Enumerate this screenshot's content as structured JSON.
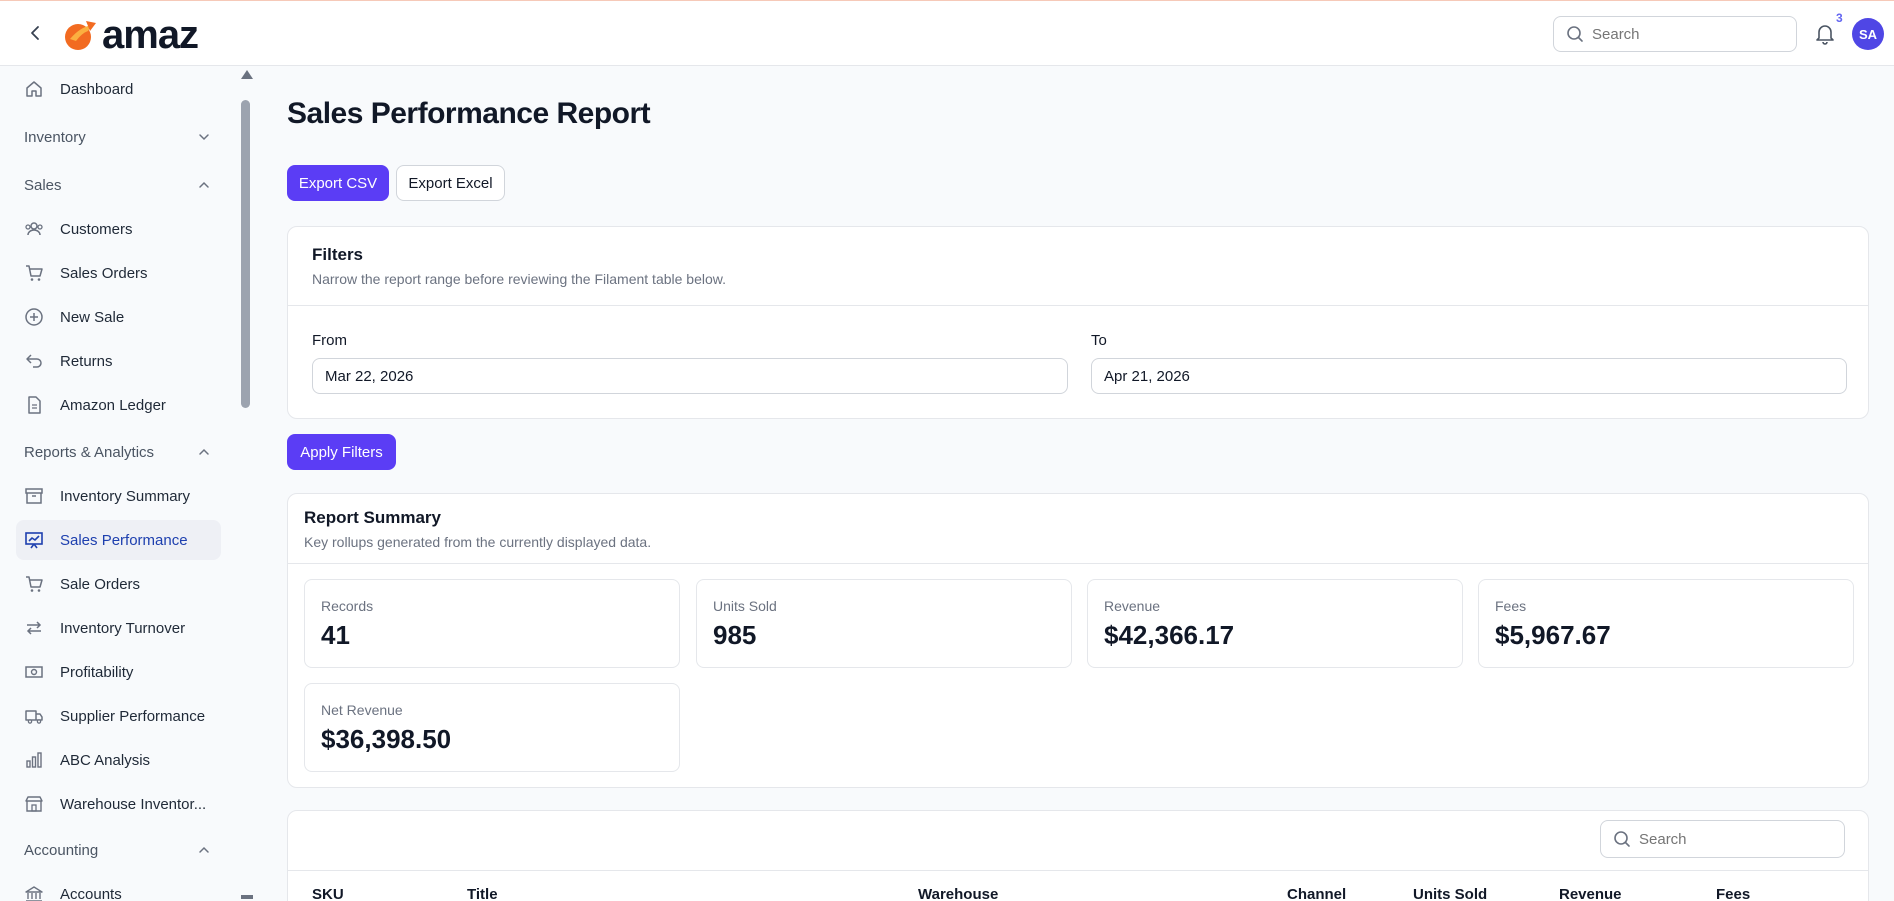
{
  "header": {
    "logo_text": "amaz",
    "search_placeholder": "Search",
    "notification_count": "3",
    "avatar_initials": "SA"
  },
  "sidebar": {
    "dashboard": "Dashboard",
    "groups": {
      "inventory": "Inventory",
      "sales": "Sales",
      "reports": "Reports & Analytics",
      "accounting": "Accounting"
    },
    "sales_items": [
      "Customers",
      "Sales Orders",
      "New Sale",
      "Returns",
      "Amazon Ledger"
    ],
    "report_items": [
      "Inventory Summary",
      "Sales Performance",
      "Sale Orders",
      "Inventory Turnover",
      "Profitability",
      "Supplier Performance",
      "ABC Analysis",
      "Warehouse Inventor..."
    ],
    "accounting_items": [
      "Accounts"
    ]
  },
  "main": {
    "title": "Sales Performance Report",
    "export_csv": "Export CSV",
    "export_excel": "Export Excel",
    "filters": {
      "title": "Filters",
      "subtitle": "Narrow the report range before reviewing the Filament table below.",
      "from_label": "From",
      "from_value": "Mar 22, 2026",
      "to_label": "To",
      "to_value": "Apr 21, 2026"
    },
    "apply_filters": "Apply Filters",
    "summary": {
      "title": "Report Summary",
      "subtitle": "Key rollups generated from the currently displayed data.",
      "stats": [
        {
          "label": "Records",
          "value": "41"
        },
        {
          "label": "Units Sold",
          "value": "985"
        },
        {
          "label": "Revenue",
          "value": "$42,366.17"
        },
        {
          "label": "Fees",
          "value": "$5,967.67"
        },
        {
          "label": "Net Revenue",
          "value": "$36,398.50"
        }
      ]
    },
    "table": {
      "search_placeholder": "Search",
      "columns": [
        "SKU",
        "Title",
        "Warehouse",
        "Channel",
        "Units Sold",
        "Revenue",
        "Fees"
      ]
    }
  },
  "colors": {
    "primary": "#5b3df5",
    "active_text": "#1e40af",
    "avatar": "#4f46e5"
  }
}
